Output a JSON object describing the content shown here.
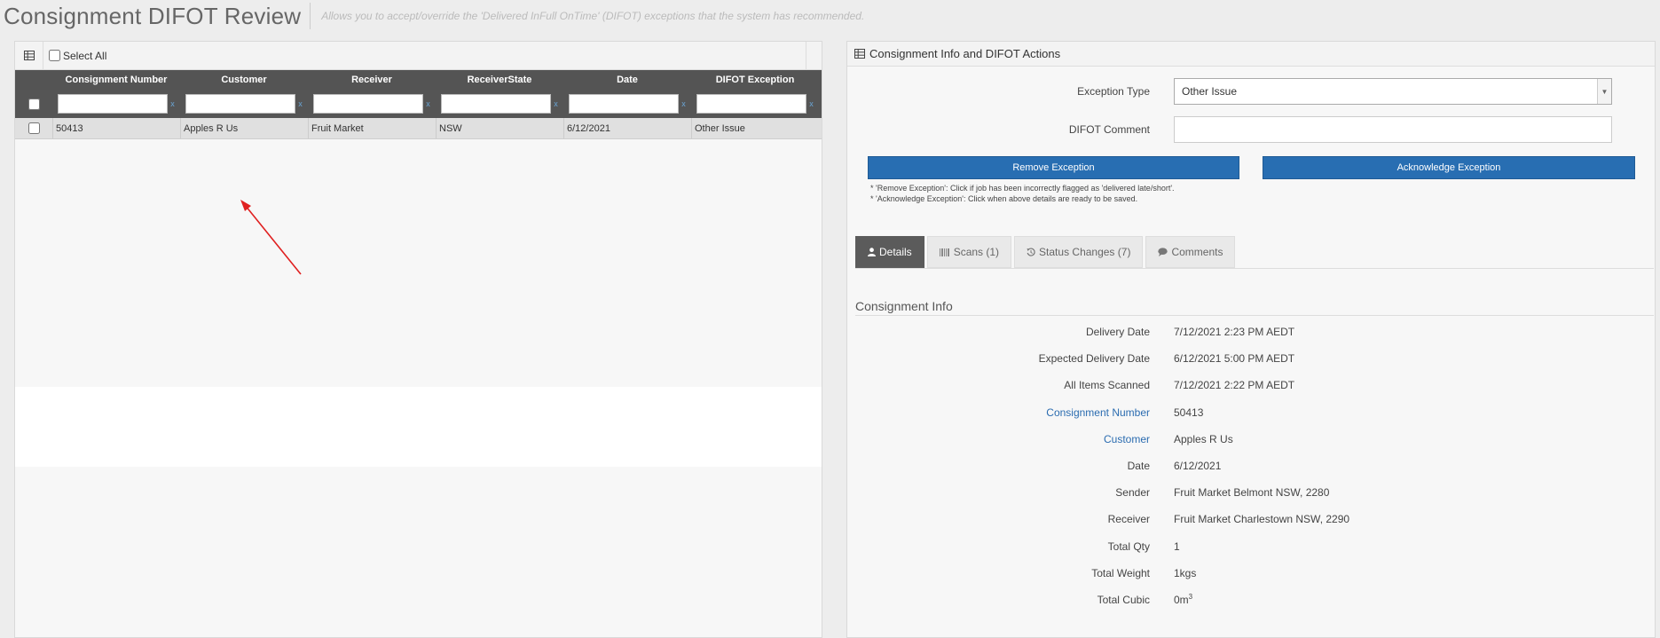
{
  "header": {
    "title": "Consignment DIFOT Review",
    "subtitle": "Allows you to accept/override the 'Delivered InFull OnTime' (DIFOT) exceptions that the system has recommended."
  },
  "grid": {
    "select_all_label": "Select All",
    "columns": [
      "Consignment Number",
      "Customer",
      "Receiver",
      "ReceiverState",
      "Date",
      "DIFOT Exception"
    ],
    "filter_clear": "x",
    "rows": [
      [
        "50413",
        "Apples R Us",
        "Fruit Market",
        "NSW",
        "6/12/2021",
        "Other Issue"
      ]
    ]
  },
  "panel": {
    "title": "Consignment Info and DIFOT Actions",
    "exception_type_label": "Exception Type",
    "exception_type_value": "Other Issue",
    "difot_comment_label": "DIFOT Comment",
    "difot_comment_value": "",
    "remove_button": "Remove Exception",
    "acknowledge_button": "Acknowledge Exception",
    "note_remove": "* 'Remove Exception': Click if job has been incorrectly flagged as 'delivered late/short'.",
    "note_acknowledge": "* 'Acknowledge Exception': Click when above details are ready to be saved."
  },
  "tabs": [
    {
      "label": "Details",
      "icon": "user-icon",
      "active": true
    },
    {
      "label": "Scans (1)",
      "icon": "barcode-icon",
      "active": false
    },
    {
      "label": "Status Changes (7)",
      "icon": "history-icon",
      "active": false
    },
    {
      "label": "Comments",
      "icon": "comment-icon",
      "active": false
    }
  ],
  "consignment_info": {
    "title": "Consignment Info",
    "fields": [
      {
        "label": "Delivery Date",
        "value": "7/12/2021 2:23 PM AEDT",
        "link": false
      },
      {
        "label": "Expected Delivery Date",
        "value": "6/12/2021 5:00 PM AEDT",
        "link": false
      },
      {
        "label": "All Items Scanned",
        "value": "7/12/2021 2:22 PM AEDT",
        "link": false
      },
      {
        "label": "Consignment Number",
        "value": "50413",
        "link": true
      },
      {
        "label": "Customer",
        "value": "Apples R Us",
        "link": true
      },
      {
        "label": "Date",
        "value": "6/12/2021",
        "link": false
      },
      {
        "label": "Sender",
        "value": "Fruit Market Belmont NSW, 2280",
        "link": false
      },
      {
        "label": "Receiver",
        "value": "Fruit Market Charlestown NSW, 2290",
        "link": false
      },
      {
        "label": "Total Qty",
        "value": "1",
        "link": false
      },
      {
        "label": "Total Weight",
        "value": "1kgs",
        "link": false
      },
      {
        "label": "Total Cubic",
        "value": "0m",
        "link": false
      }
    ],
    "cubic_exponent": "3"
  },
  "colors": {
    "button": "#286eb2",
    "grid_header": "#545454",
    "link": "#2b6cb0",
    "annotation_arrow": "#e02020"
  }
}
